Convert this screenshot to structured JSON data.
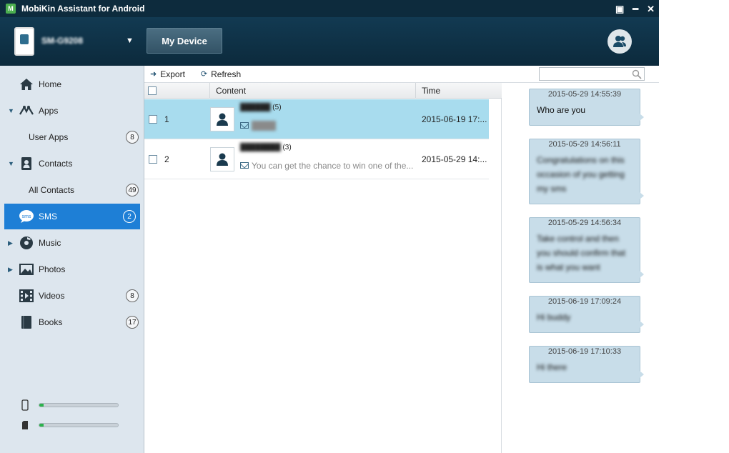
{
  "window": {
    "title": "MobiKin Assistant for Android",
    "controls": {
      "settings": "▣",
      "minimize": "━",
      "close": "✕"
    }
  },
  "header": {
    "device_name": "SM-G9208",
    "dropdown": "▼",
    "my_device_label": "My Device"
  },
  "sidebar": {
    "items": [
      {
        "label": "Home",
        "icon": "home-icon"
      },
      {
        "label": "Apps",
        "icon": "apps-icon",
        "expand": "▼"
      },
      {
        "label": "User Apps",
        "count": "8"
      },
      {
        "label": "Contacts",
        "icon": "contacts-icon",
        "expand": "▼"
      },
      {
        "label": "All Contacts",
        "count": "49"
      },
      {
        "label": "SMS",
        "icon": "sms-icon",
        "count": "2"
      },
      {
        "label": "Music",
        "icon": "music-icon",
        "expand": "▶"
      },
      {
        "label": "Photos",
        "icon": "photos-icon",
        "expand": "▶"
      },
      {
        "label": "Videos",
        "icon": "videos-icon",
        "count": "8"
      },
      {
        "label": "Books",
        "icon": "books-icon",
        "count": "17"
      }
    ],
    "storage": [
      {
        "icon": "phone-storage-icon",
        "fill": 0.05
      },
      {
        "icon": "sd-card-icon",
        "fill": 0.05
      }
    ]
  },
  "toolbar": {
    "export_label": "Export",
    "refresh_label": "Refresh",
    "search_placeholder": ""
  },
  "table": {
    "columns": [
      "Content",
      "Time"
    ],
    "rows": [
      {
        "index": "1",
        "sender": "██████",
        "count": "(5)",
        "preview": "████",
        "time": "2015-06-19 17:..."
      },
      {
        "index": "2",
        "sender": "████████",
        "count": "(3)",
        "preview": "You can get the chance to win one of the...",
        "time": "2015-05-29 14:..."
      }
    ]
  },
  "messages": [
    {
      "timestamp": "2015-05-29 14:55:39",
      "text": "Who are you",
      "blurred": false
    },
    {
      "timestamp": "2015-05-29 14:56:11",
      "text": "Congratulations on this occasion of you getting my sms",
      "blurred": true
    },
    {
      "timestamp": "2015-05-29 14:56:34",
      "text": "Take control and then you should confirm that is what you want",
      "blurred": true
    },
    {
      "timestamp": "2015-06-19 17:09:24",
      "text": "Hi buddy",
      "blurred": true
    },
    {
      "timestamp": "2015-06-19 17:10:33",
      "text": "Hi there",
      "blurred": true
    }
  ],
  "colors": {
    "titlebar": "#0d2b3d",
    "header": "#123a52",
    "sidebar": "#dde6ee",
    "active": "#1e7fd6",
    "selected_row": "#a8dcee",
    "bubble": "#c8dde9"
  }
}
